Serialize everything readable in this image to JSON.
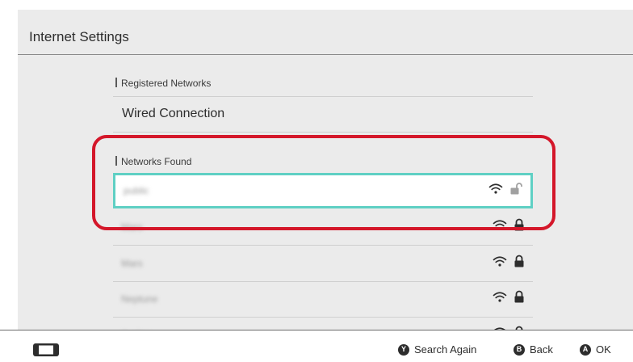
{
  "page": {
    "title": "Internet Settings"
  },
  "registered": {
    "header": "Registered Networks",
    "items": [
      {
        "label": "Wired Connection"
      }
    ]
  },
  "found": {
    "header": "Networks Found",
    "networks": [
      {
        "name": "public",
        "signal_icon": "wifi-icon",
        "lock_icon": "unlocked-icon",
        "secured": false,
        "selected": true
      },
      {
        "name": "Mars",
        "signal_icon": "wifi-icon",
        "lock_icon": "lock-icon",
        "secured": true,
        "selected": false
      },
      {
        "name": "Mars",
        "signal_icon": "wifi-icon",
        "lock_icon": "lock-icon",
        "secured": true,
        "selected": false
      },
      {
        "name": "Neptune",
        "signal_icon": "wifi-icon",
        "lock_icon": "lock-icon",
        "secured": true,
        "selected": false
      },
      {
        "name": "Jupiter",
        "signal_icon": "wifi-icon",
        "lock_icon": "lock-icon",
        "secured": true,
        "selected": false
      }
    ]
  },
  "footer": {
    "search_again": {
      "glyph": "Y",
      "label": "Search Again"
    },
    "back": {
      "glyph": "B",
      "label": "Back"
    },
    "ok": {
      "glyph": "A",
      "label": "OK"
    }
  },
  "colors": {
    "selection": "#5fd0c4",
    "annotation": "#d4172a",
    "panel": "#ebebeb"
  }
}
